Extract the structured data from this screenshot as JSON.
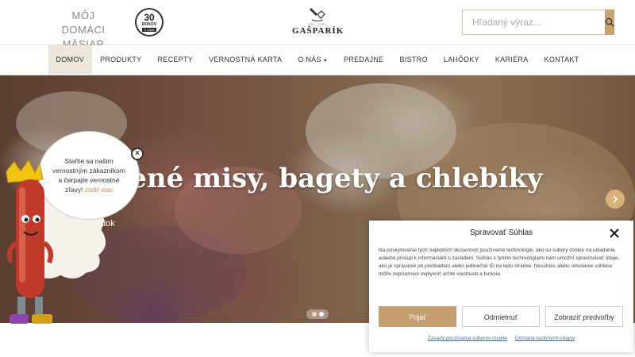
{
  "header": {
    "brand_line1": "MÔJ DOMÁCI",
    "brand_line2": "MÄSIAR",
    "badge": {
      "number": "30",
      "line": "ROKOV",
      "ribbon": "S VAMI"
    },
    "logo": {
      "est": "EST. 1991",
      "name": "GAŠPARÍK"
    },
    "search": {
      "placeholder": "Hľadaný výraz..."
    }
  },
  "nav": {
    "items": [
      {
        "label": "DOMOV",
        "active": true
      },
      {
        "label": "PRODUKTY"
      },
      {
        "label": "RECEPTY"
      },
      {
        "label": "VERNOSTNÁ KARTA"
      },
      {
        "label": "O NÁS"
      },
      {
        "label": "PREDAJNE"
      },
      {
        "label": "BISTRO"
      },
      {
        "label": "LAHÔDKY"
      },
      {
        "label": "KARIÉRA"
      },
      {
        "label": "KONTAKT"
      }
    ]
  },
  "hero": {
    "title": "Obložené misy, bagety a chlebíky",
    "link": "Ponuka lahôdok",
    "slides": 2,
    "active_slide": 2
  },
  "mascot": {
    "text": "Staňte sa našim vernostným zákazníkom a čerpajte vernostné zľavy!",
    "link": "zistiť viac"
  },
  "cookie": {
    "title": "Spravovať Súhlas",
    "body": "Na poskytovanie tých najlepších skúseností používame technológie, ako sú súbory cookie na ukladanie a/alebo prístup k informáciám o zariadení. Súhlas s týmito technológiami nám umožní spracovávať údaje, ako je správanie pri prehliadaní alebo jedinečné ID na tejto stránke. Nesúhlas alebo odvolanie súhlasu môže nepriaznivo ovplyvniť určité vlastnosti a funkcie.",
    "accept": "Prijať",
    "deny": "Odmietnuť",
    "preferences": "Zobraziť predvoľby",
    "link1": "Zásady používania súborov cookie",
    "link2": "Ochrana osobných údajov"
  },
  "colors": {
    "accent": "#c9a274",
    "button": "#c59f6e"
  }
}
